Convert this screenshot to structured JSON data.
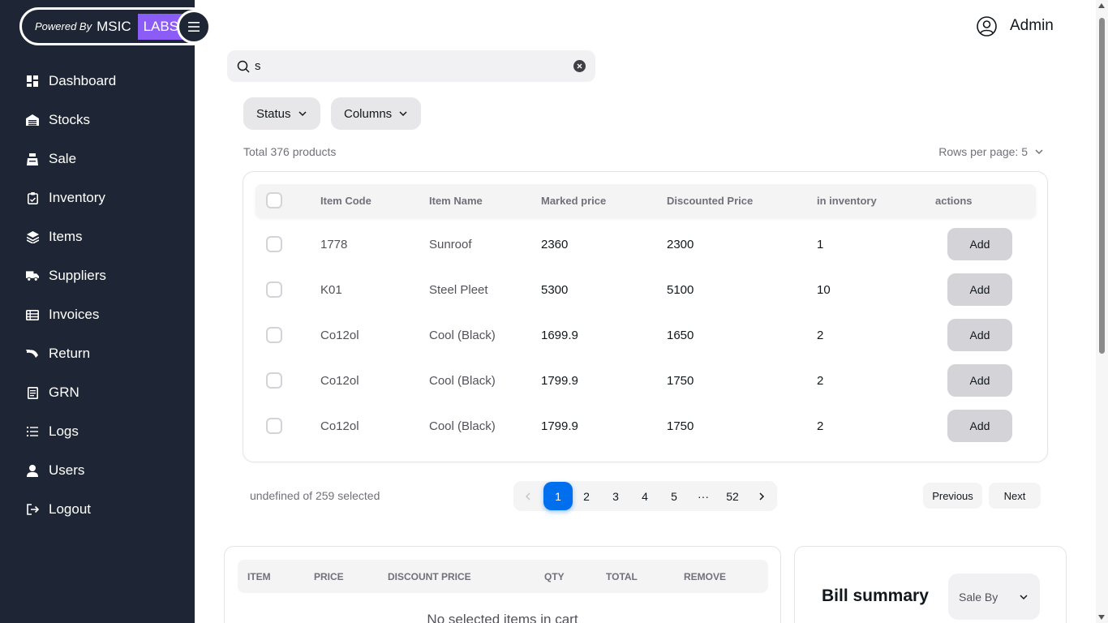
{
  "brand": {
    "powered_by": "Powered By",
    "name": "MSIC",
    "labs": "LABS"
  },
  "sidebar": {
    "items": [
      {
        "label": "Dashboard",
        "icon": "dashboard-icon"
      },
      {
        "label": "Stocks",
        "icon": "warehouse-icon"
      },
      {
        "label": "Sale",
        "icon": "cash-register-icon"
      },
      {
        "label": "Inventory",
        "icon": "clipboard-icon"
      },
      {
        "label": "Items",
        "icon": "layers-icon"
      },
      {
        "label": "Suppliers",
        "icon": "truck-icon"
      },
      {
        "label": "Invoices",
        "icon": "table-list-icon"
      },
      {
        "label": "Return",
        "icon": "return-icon"
      },
      {
        "label": "GRN",
        "icon": "receipt-icon"
      },
      {
        "label": "Logs",
        "icon": "list-icon"
      },
      {
        "label": "Users",
        "icon": "user-icon"
      },
      {
        "label": "Logout",
        "icon": "logout-icon"
      }
    ]
  },
  "header": {
    "user_name": "Admin"
  },
  "search": {
    "value": "s"
  },
  "filters": {
    "status_label": "Status",
    "columns_label": "Columns"
  },
  "summary": {
    "total_text": "Total 376 products",
    "rows_per_page_text": "Rows per page: 5"
  },
  "table": {
    "headers": {
      "item_code": "Item Code",
      "item_name": "Item Name",
      "marked_price": "Marked price",
      "discounted_price": "Discounted Price",
      "in_inventory": "in inventory",
      "actions": "actions"
    },
    "action_label": "Add",
    "rows": [
      {
        "code": "1778",
        "name": "Sunroof",
        "marked": "2360",
        "discounted": "2300",
        "inventory": "1"
      },
      {
        "code": "K01",
        "name": "Steel Pleet",
        "marked": "5300",
        "discounted": "5100",
        "inventory": "10"
      },
      {
        "code": "Co12ol",
        "name": "Cool (Black)",
        "marked": "1699.9",
        "discounted": "1650",
        "inventory": "2"
      },
      {
        "code": "Co12ol",
        "name": "Cool (Black)",
        "marked": "1799.9",
        "discounted": "1750",
        "inventory": "2"
      },
      {
        "code": "Co12ol",
        "name": "Cool (Black)",
        "marked": "1799.9",
        "discounted": "1750",
        "inventory": "2"
      }
    ]
  },
  "pagination": {
    "selected_text": "undefined of 259 selected",
    "pages": [
      "1",
      "2",
      "3",
      "4",
      "5",
      "···",
      "52"
    ],
    "active_page": "1",
    "previous_label": "Previous",
    "next_label": "Next"
  },
  "cart": {
    "headers": {
      "item": "ITEM",
      "price": "PRICE",
      "discount_price": "DISCOUNT PRICE",
      "qty": "QTY",
      "total": "TOTAL",
      "remove": "REMOVE"
    },
    "empty_text": "No selected items in cart"
  },
  "bill": {
    "title": "Bill summary",
    "sale_by_label": "Sale By"
  },
  "colors": {
    "sidebar_bg": "#1e2635",
    "labs_bg": "#8b5cf6",
    "primary": "#006fee"
  }
}
